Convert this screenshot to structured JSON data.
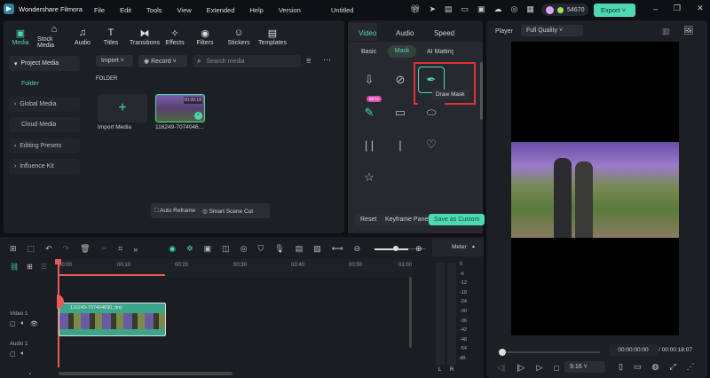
{
  "app": {
    "title": "Wondershare Filmora",
    "doc_title": "Untitled",
    "credits": "54670",
    "export": "Export"
  },
  "menu": [
    "File",
    "Edit",
    "Tools",
    "View",
    "Extended",
    "Help",
    "Version"
  ],
  "toolbar": [
    "Media",
    "Stock Media",
    "Audio",
    "Titles",
    "Transitions",
    "Effects",
    "Filters",
    "Stickers",
    "Templates"
  ],
  "sidebar": [
    "Project Media",
    "Folder",
    "Global Media",
    "Cloud Media",
    "Editing Presets",
    "Influence Kit"
  ],
  "media": {
    "import": "Import",
    "record": "Record",
    "search_placeholder": "Search media",
    "folder": "FOLDER",
    "import_media": "Import Media",
    "clip_name": "116249-7074046...",
    "clip_duration": "00:00:18",
    "auto_reframe": "Auto Reframe",
    "smart_scene_cut": "Smart Scene Cut"
  },
  "props": {
    "tabs": [
      "Video",
      "Audio",
      "Speed"
    ],
    "subtabs": [
      "Basic",
      "Mask",
      "AI Matting"
    ],
    "beta": "BETA",
    "tooltip": "Draw Mask",
    "reset": "Reset",
    "keyframe": "Keyframe Panel",
    "save_custom": "Save as Custom"
  },
  "player": {
    "label": "Player",
    "quality": "Full Quality",
    "current": "00:00:00:00",
    "total": "/ 00:00:18:07",
    "ratio": "9:16"
  },
  "timeline": {
    "ticks": [
      "00:00",
      "00:10",
      "00:20",
      "00:30",
      "00:40",
      "00:50",
      "01:00"
    ],
    "video_track": "Video 1",
    "audio_track": "Audio 1",
    "clip": "116249-707404690_tiny",
    "meter": "Meter",
    "db": [
      "0",
      "-6",
      "-12",
      "-18",
      "-24",
      "-30",
      "-36",
      "-42",
      "-48",
      "-54",
      "dB"
    ],
    "lr": [
      "L",
      "R"
    ]
  },
  "colors": {
    "accent": "#4fd8b4",
    "highlight": "#e0303a",
    "playhead": "#e85a5a"
  }
}
